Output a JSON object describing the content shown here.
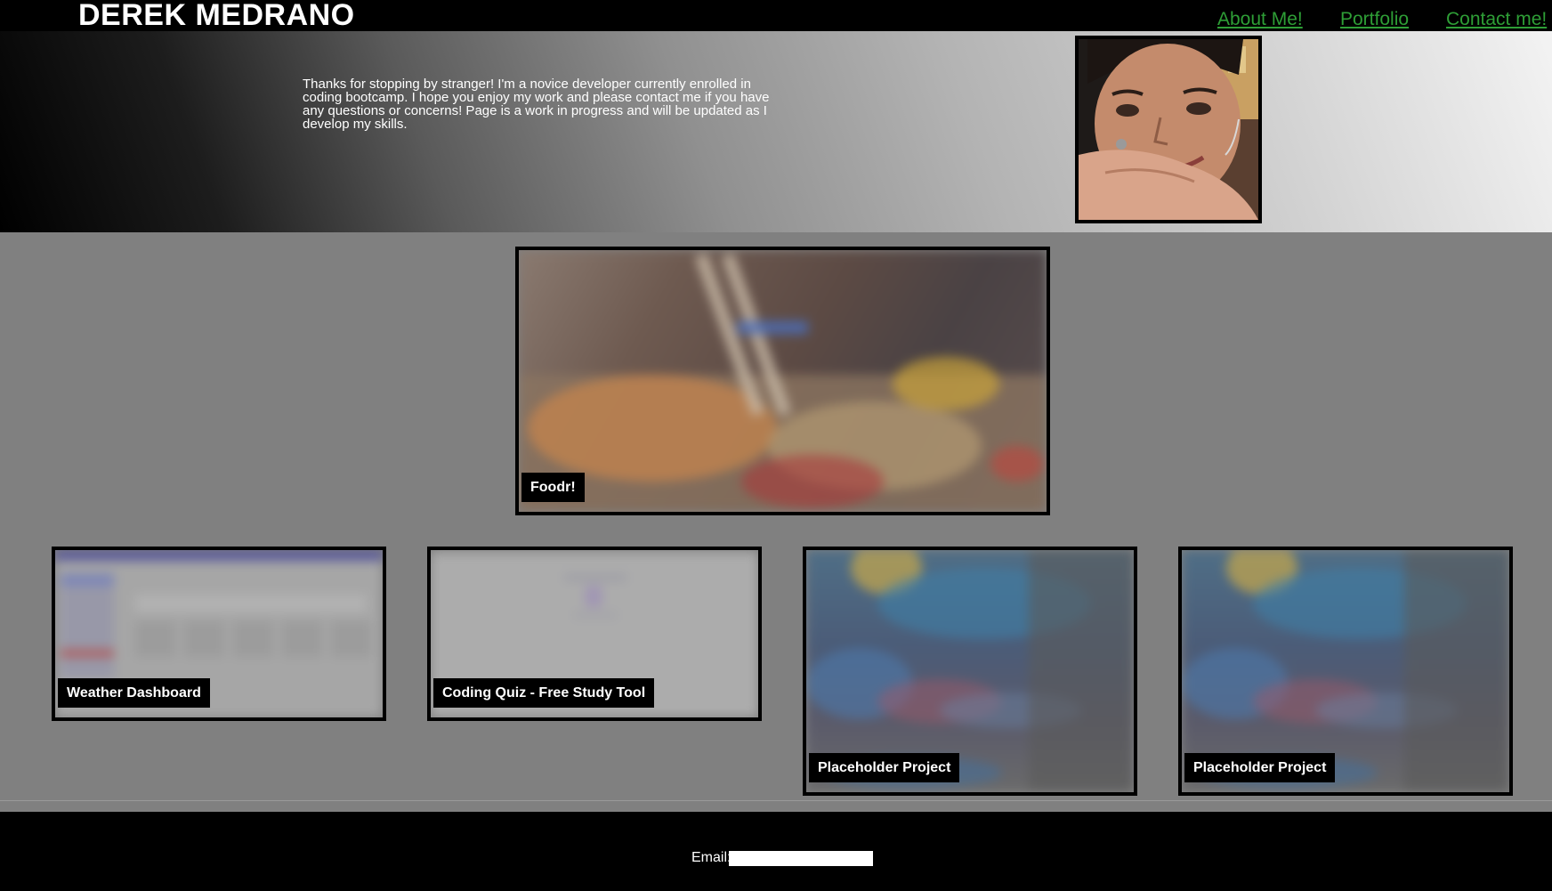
{
  "header": {
    "title": "DEREK MEDRANO",
    "nav": [
      "About Me!",
      "Portfolio",
      "Contact me!"
    ],
    "nav_color": "#2e9e36"
  },
  "hero": {
    "intro": "Thanks for stopping by stranger! I'm a novice developer currently enrolled in coding bootcamp. I hope you enjoy my work and please contact me if you have any questions or concerns! Page is a work in progress and will be updated as I develop my skills."
  },
  "projects": {
    "featured": "Foodr!",
    "items": [
      "Weather Dashboard",
      "Coding Quiz - Free Study Tool",
      "Placeholder Project",
      "Placeholder Project"
    ]
  },
  "footer": {
    "email_label": "Email:",
    "email_value": ""
  }
}
